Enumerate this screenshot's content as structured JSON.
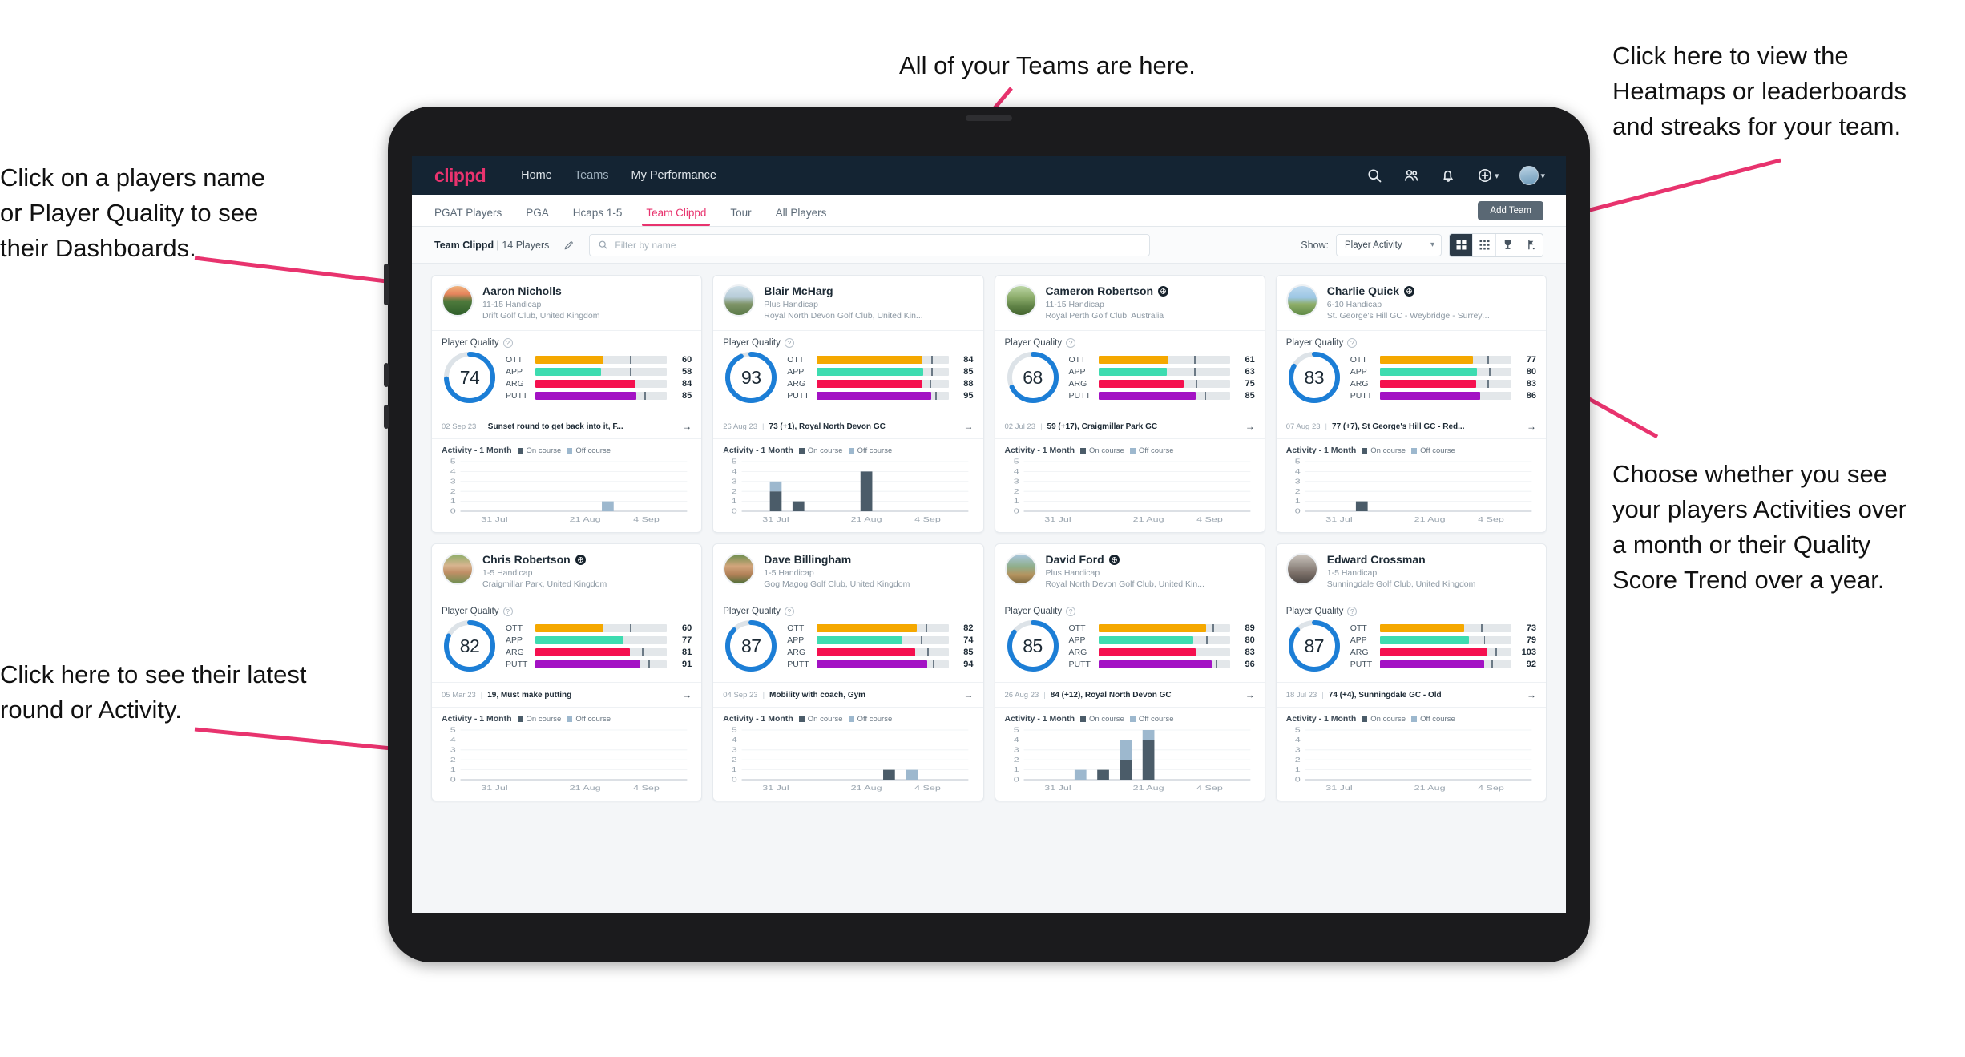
{
  "annotations": [
    {
      "id": "players-name",
      "text": "Click on a players name\nor Player Quality to see\ntheir Dashboards."
    },
    {
      "id": "teams-here",
      "text": "All of your Teams are here."
    },
    {
      "id": "heatmaps",
      "text": "Click here to view the\nHeatmaps or leaderboards\nand streaks for your team."
    },
    {
      "id": "activity-choice",
      "text": "Choose whether you see\nyour players Activities over\na month or their Quality\nScore Trend over a year."
    },
    {
      "id": "latest-round",
      "text": "Click here to see their latest\nround or Activity."
    }
  ],
  "arrow_color": "#e8336e",
  "app": {
    "brand": "clippd",
    "nav": [
      {
        "label": "Home",
        "active": true
      },
      {
        "label": "Teams",
        "active": false
      },
      {
        "label": "My Performance",
        "active": false
      }
    ],
    "nav_icons": [
      "search-icon",
      "people-icon",
      "bell-icon",
      "plus-circle-icon",
      "avatar"
    ],
    "tabs": [
      {
        "label": "PGAT Players",
        "active": false
      },
      {
        "label": "PGA",
        "active": false
      },
      {
        "label": "Hcaps 1-5",
        "active": false
      },
      {
        "label": "Team Clippd",
        "active": true
      },
      {
        "label": "Tour",
        "active": false
      },
      {
        "label": "All Players",
        "active": false
      }
    ],
    "add_team_label": "Add Team",
    "toolbar": {
      "team_name": "Team Clippd",
      "team_count": "14 Players",
      "separator": "|",
      "edit_icon": "pencil-icon",
      "search_placeholder": "Filter by name",
      "search_value": "",
      "show_label": "Show:",
      "show_value": "Player Activity",
      "show_options": [
        "Player Activity",
        "Quality Score Trend"
      ],
      "view_buttons": [
        "grid-large-icon",
        "grid-small-icon",
        "trophy-icon",
        "flag-icon"
      ],
      "view_active_index": 0
    }
  },
  "card_labels": {
    "player_quality": "Player Quality",
    "help_icon": "?",
    "activity_title": "Activity - 1 Month",
    "legend_on": "On course",
    "legend_off": "Off course",
    "arrow": "→"
  },
  "colors": {
    "ott": "#f5a800",
    "app": "#3ddcb0",
    "arg": "#f5104f",
    "putt": "#a312c4",
    "ring": "#1c7ed6",
    "ring_track": "#dde3e8",
    "on_course": "#4b5c69",
    "off_course": "#9db8ce",
    "accent": "#e8336e"
  },
  "chart_data": {
    "type": "bar",
    "title": "Activity - 1 Month",
    "ylabel": "",
    "xlabel": "",
    "ylim": [
      0,
      5
    ],
    "yticks": [
      0,
      1,
      2,
      3,
      4,
      5
    ],
    "xticks": [
      "31 Jul",
      "21 Aug",
      "4 Sep"
    ],
    "grid": true,
    "legend": [
      "On course",
      "Off course"
    ],
    "legend_position": "top",
    "stacked": true,
    "charts": [
      {
        "player": "Aaron Nicholls",
        "bins": 10,
        "series": [
          {
            "name": "On course",
            "values": [
              0,
              0,
              0,
              0,
              0,
              0,
              0,
              0,
              0,
              0
            ]
          },
          {
            "name": "Off course",
            "values": [
              0,
              0,
              0,
              0,
              0,
              0,
              1,
              0,
              0,
              0
            ]
          }
        ]
      },
      {
        "player": "Blair McHarg",
        "bins": 10,
        "series": [
          {
            "name": "On course",
            "values": [
              0,
              2,
              1,
              0,
              0,
              4,
              0,
              0,
              0,
              0
            ]
          },
          {
            "name": "Off course",
            "values": [
              0,
              1,
              0,
              0,
              0,
              0,
              0,
              0,
              0,
              0
            ]
          }
        ]
      },
      {
        "player": "Cameron Robertson",
        "bins": 10,
        "series": [
          {
            "name": "On course",
            "values": [
              0,
              0,
              0,
              0,
              0,
              0,
              0,
              0,
              0,
              0
            ]
          },
          {
            "name": "Off course",
            "values": [
              0,
              0,
              0,
              0,
              0,
              0,
              0,
              0,
              0,
              0
            ]
          }
        ]
      },
      {
        "player": "Charlie Quick",
        "bins": 10,
        "series": [
          {
            "name": "On course",
            "values": [
              0,
              0,
              1,
              0,
              0,
              0,
              0,
              0,
              0,
              0
            ]
          },
          {
            "name": "Off course",
            "values": [
              0,
              0,
              0,
              0,
              0,
              0,
              0,
              0,
              0,
              0
            ]
          }
        ]
      },
      {
        "player": "Chris Robertson",
        "bins": 10,
        "series": [
          {
            "name": "On course",
            "values": [
              0,
              0,
              0,
              0,
              0,
              0,
              0,
              0,
              0,
              0
            ]
          },
          {
            "name": "Off course",
            "values": [
              0,
              0,
              0,
              0,
              0,
              0,
              0,
              0,
              0,
              0
            ]
          }
        ]
      },
      {
        "player": "Dave Billingham",
        "bins": 10,
        "series": [
          {
            "name": "On course",
            "values": [
              0,
              0,
              0,
              0,
              0,
              0,
              1,
              0,
              0,
              0
            ]
          },
          {
            "name": "Off course",
            "values": [
              0,
              0,
              0,
              0,
              0,
              0,
              0,
              1,
              0,
              0
            ]
          }
        ]
      },
      {
        "player": "David Ford",
        "bins": 10,
        "series": [
          {
            "name": "On course",
            "values": [
              0,
              0,
              0,
              1,
              2,
              4,
              0,
              0,
              0,
              0
            ]
          },
          {
            "name": "Off course",
            "values": [
              0,
              0,
              1,
              0,
              2,
              1,
              0,
              0,
              0,
              0
            ]
          }
        ]
      },
      {
        "player": "Edward Crossman",
        "bins": 10,
        "series": [
          {
            "name": "On course",
            "values": [
              0,
              0,
              0,
              0,
              0,
              0,
              0,
              0,
              0,
              0
            ]
          },
          {
            "name": "Off course",
            "values": [
              0,
              0,
              0,
              0,
              0,
              0,
              0,
              0,
              0,
              0
            ]
          }
        ]
      }
    ]
  },
  "players": [
    {
      "name": "Aaron Nicholls",
      "verified": false,
      "avatar": "av-sunset",
      "handicap": "11-15 Handicap",
      "club": "Drift Golf Club, United Kingdom",
      "quality": 74,
      "metrics": [
        {
          "label": "OTT",
          "value": 60,
          "fill": 52,
          "tick": 72
        },
        {
          "label": "APP",
          "value": 58,
          "fill": 50,
          "tick": 72
        },
        {
          "label": "ARG",
          "value": 84,
          "fill": 76,
          "tick": 82
        },
        {
          "label": "PUTT",
          "value": 85,
          "fill": 77,
          "tick": 83
        }
      ],
      "round_date": "02 Sep 23",
      "round_text": "Sunset round to get back into it, F..."
    },
    {
      "name": "Blair McHarg",
      "verified": false,
      "avatar": "av-links",
      "handicap": "Plus Handicap",
      "club": "Royal North Devon Golf Club, United Kin...",
      "quality": 93,
      "metrics": [
        {
          "label": "OTT",
          "value": 84,
          "fill": 80,
          "tick": 87
        },
        {
          "label": "APP",
          "value": 85,
          "fill": 81,
          "tick": 87
        },
        {
          "label": "ARG",
          "value": 88,
          "fill": 80,
          "tick": 86
        },
        {
          "label": "PUTT",
          "value": 95,
          "fill": 87,
          "tick": 90
        }
      ],
      "round_date": "26 Aug 23",
      "round_text": "73 (+1), Royal North Devon GC"
    },
    {
      "name": "Cameron Robertson",
      "verified": true,
      "avatar": "av-perth",
      "handicap": "11-15 Handicap",
      "club": "Royal Perth Golf Club, Australia",
      "quality": 68,
      "metrics": [
        {
          "label": "OTT",
          "value": 61,
          "fill": 53,
          "tick": 73
        },
        {
          "label": "APP",
          "value": 63,
          "fill": 52,
          "tick": 73
        },
        {
          "label": "ARG",
          "value": 75,
          "fill": 65,
          "tick": 74
        },
        {
          "label": "PUTT",
          "value": 85,
          "fill": 74,
          "tick": 81
        }
      ],
      "round_date": "02 Jul 23",
      "round_text": "59 (+17), Craigmillar Park GC"
    },
    {
      "name": "Charlie Quick",
      "verified": true,
      "avatar": "av-stg",
      "handicap": "6-10 Handicap",
      "club": "St. George's Hill GC - Weybridge - Surrey, ...",
      "quality": 83,
      "metrics": [
        {
          "label": "OTT",
          "value": 77,
          "fill": 71,
          "tick": 82
        },
        {
          "label": "APP",
          "value": 80,
          "fill": 74,
          "tick": 83
        },
        {
          "label": "ARG",
          "value": 83,
          "fill": 73,
          "tick": 82
        },
        {
          "label": "PUTT",
          "value": 86,
          "fill": 76,
          "tick": 84
        }
      ],
      "round_date": "07 Aug 23",
      "round_text": "77 (+7), St George's Hill GC - Red..."
    },
    {
      "name": "Chris Robertson",
      "verified": true,
      "avatar": "av-chris",
      "handicap": "1-5 Handicap",
      "club": "Craigmillar Park, United Kingdom",
      "quality": 82,
      "metrics": [
        {
          "label": "OTT",
          "value": 60,
          "fill": 52,
          "tick": 72
        },
        {
          "label": "APP",
          "value": 77,
          "fill": 67,
          "tick": 79
        },
        {
          "label": "ARG",
          "value": 81,
          "fill": 72,
          "tick": 81
        },
        {
          "label": "PUTT",
          "value": 91,
          "fill": 80,
          "tick": 86
        }
      ],
      "round_date": "05 Mar 23",
      "round_text": "19, Must make putting"
    },
    {
      "name": "Dave Billingham",
      "verified": false,
      "avatar": "av-dave",
      "handicap": "1-5 Handicap",
      "club": "Gog Magog Golf Club, United Kingdom",
      "quality": 87,
      "metrics": [
        {
          "label": "OTT",
          "value": 82,
          "fill": 76,
          "tick": 83
        },
        {
          "label": "APP",
          "value": 74,
          "fill": 65,
          "tick": 79
        },
        {
          "label": "ARG",
          "value": 85,
          "fill": 75,
          "tick": 84
        },
        {
          "label": "PUTT",
          "value": 94,
          "fill": 84,
          "tick": 88
        }
      ],
      "round_date": "04 Sep 23",
      "round_text": "Mobility with coach, Gym"
    },
    {
      "name": "David Ford",
      "verified": true,
      "avatar": "av-ford",
      "handicap": "Plus Handicap",
      "club": "Royal North Devon Golf Club, United Kin...",
      "quality": 85,
      "metrics": [
        {
          "label": "OTT",
          "value": 89,
          "fill": 82,
          "tick": 87
        },
        {
          "label": "APP",
          "value": 80,
          "fill": 72,
          "tick": 82
        },
        {
          "label": "ARG",
          "value": 83,
          "fill": 74,
          "tick": 83
        },
        {
          "label": "PUTT",
          "value": 96,
          "fill": 86,
          "tick": 89
        }
      ],
      "round_date": "26 Aug 23",
      "round_text": "84 (+12), Royal North Devon GC"
    },
    {
      "name": "Edward Crossman",
      "verified": false,
      "avatar": "av-edward",
      "handicap": "1-5 Handicap",
      "club": "Sunningdale Golf Club, United Kingdom",
      "quality": 87,
      "metrics": [
        {
          "label": "OTT",
          "value": 73,
          "fill": 64,
          "tick": 77
        },
        {
          "label": "APP",
          "value": 79,
          "fill": 68,
          "tick": 79
        },
        {
          "label": "ARG",
          "value": 103,
          "fill": 82,
          "tick": 88
        },
        {
          "label": "PUTT",
          "value": 92,
          "fill": 79,
          "tick": 85
        }
      ],
      "round_date": "18 Jul 23",
      "round_text": "74 (+4), Sunningdale GC - Old"
    }
  ]
}
